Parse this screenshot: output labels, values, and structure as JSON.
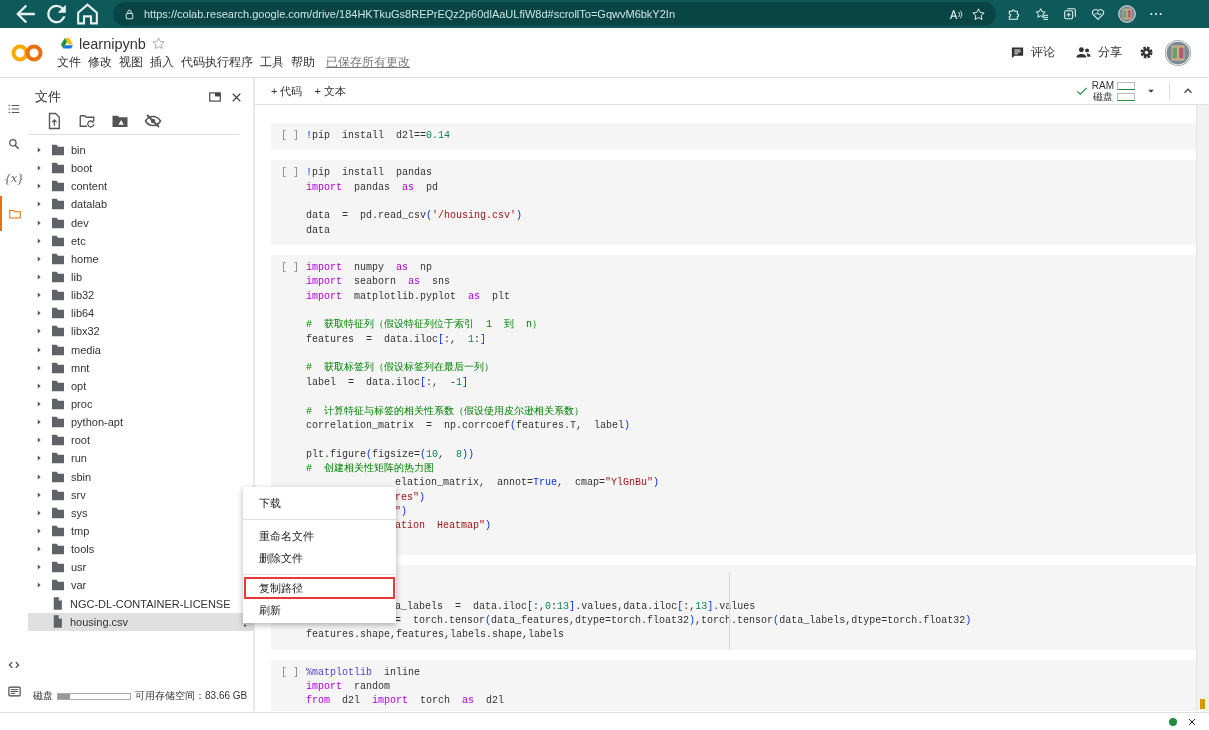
{
  "browser": {
    "url": "https://colab.research.google.com/drive/184HKTkuGs8REPrEQz2p60dlAaULfiW8d#scrollTo=GqwvM6bkY2In"
  },
  "header": {
    "title": "learnipynb",
    "menu": [
      "文件",
      "修改",
      "视图",
      "插入",
      "代码执行程序",
      "工具",
      "帮助"
    ],
    "save_status": "已保存所有更改",
    "comment": "评论",
    "share": "分享"
  },
  "toolbar": {
    "add_code": "+ 代码",
    "add_text": "+ 文本",
    "ram": "RAM",
    "disk": "磁盘"
  },
  "rail": [
    {
      "kind": "toc",
      "selected": false
    },
    {
      "kind": "search",
      "selected": false
    },
    {
      "kind": "variables",
      "glyph": "{x}",
      "selected": false
    },
    {
      "kind": "files",
      "selected": true
    }
  ],
  "rail_bottom": [
    {
      "kind": "code"
    },
    {
      "kind": "terminal"
    }
  ],
  "files": {
    "title": "文件",
    "items": [
      {
        "name": "bin",
        "kind": "folder",
        "selected": false
      },
      {
        "name": "boot",
        "kind": "folder",
        "selected": false
      },
      {
        "name": "content",
        "kind": "folder",
        "selected": false
      },
      {
        "name": "datalab",
        "kind": "folder",
        "selected": false
      },
      {
        "name": "dev",
        "kind": "folder",
        "selected": false
      },
      {
        "name": "etc",
        "kind": "folder",
        "selected": false
      },
      {
        "name": "home",
        "kind": "folder",
        "selected": false
      },
      {
        "name": "lib",
        "kind": "folder",
        "selected": false
      },
      {
        "name": "lib32",
        "kind": "folder",
        "selected": false
      },
      {
        "name": "lib64",
        "kind": "folder",
        "selected": false
      },
      {
        "name": "libx32",
        "kind": "folder",
        "selected": false
      },
      {
        "name": "media",
        "kind": "folder",
        "selected": false
      },
      {
        "name": "mnt",
        "kind": "folder",
        "selected": false
      },
      {
        "name": "opt",
        "kind": "folder",
        "selected": false
      },
      {
        "name": "proc",
        "kind": "folder",
        "selected": false
      },
      {
        "name": "python-apt",
        "kind": "folder",
        "selected": false
      },
      {
        "name": "root",
        "kind": "folder",
        "selected": false
      },
      {
        "name": "run",
        "kind": "folder",
        "selected": false
      },
      {
        "name": "sbin",
        "kind": "folder",
        "selected": false
      },
      {
        "name": "srv",
        "kind": "folder",
        "selected": false
      },
      {
        "name": "sys",
        "kind": "folder",
        "selected": false
      },
      {
        "name": "tmp",
        "kind": "folder",
        "selected": false
      },
      {
        "name": "tools",
        "kind": "folder",
        "selected": false
      },
      {
        "name": "usr",
        "kind": "folder",
        "selected": false
      },
      {
        "name": "var",
        "kind": "folder",
        "selected": false
      },
      {
        "name": "NGC-DL-CONTAINER-LICENSE",
        "kind": "file",
        "selected": false
      },
      {
        "name": "housing.csv",
        "kind": "file",
        "selected": true
      }
    ],
    "disk": {
      "label": "磁盘",
      "level": 0.17,
      "free": "可用存储空间：83.66 GB"
    }
  },
  "cells": [
    {
      "run_label": "[ ]",
      "ruler": false,
      "lines": [
        {
          "kind": "code",
          "tokens": [
            {
              "kind": "b",
              "text": "!"
            },
            {
              "kind": "p",
              "text": "pip  install  d2l=="
            },
            {
              "kind": "n",
              "text": "0.14"
            }
          ]
        }
      ]
    },
    {
      "run_label": "[ ]",
      "ruler": false,
      "lines": [
        {
          "kind": "code",
          "tokens": [
            {
              "kind": "b",
              "text": "!"
            },
            {
              "kind": "p",
              "text": "pip  install  pandas"
            }
          ]
        },
        {
          "kind": "code",
          "tokens": [
            {
              "kind": "k",
              "text": "import"
            },
            {
              "kind": "p",
              "text": "  pandas  "
            },
            {
              "kind": "k",
              "text": "as"
            },
            {
              "kind": "p",
              "text": "  pd"
            }
          ]
        },
        {
          "kind": "blank"
        },
        {
          "kind": "code",
          "tokens": [
            {
              "kind": "p",
              "text": "data  =  pd.read_csv"
            },
            {
              "kind": "b",
              "text": "("
            },
            {
              "kind": "s",
              "text": "'/housing.csv'"
            },
            {
              "kind": "b",
              "text": ")"
            }
          ]
        },
        {
          "kind": "code",
          "tokens": [
            {
              "kind": "p",
              "text": "data"
            }
          ]
        }
      ]
    },
    {
      "run_label": "[ ]",
      "ruler": false,
      "lines": [
        {
          "kind": "code",
          "tokens": [
            {
              "kind": "k",
              "text": "import"
            },
            {
              "kind": "p",
              "text": "  numpy  "
            },
            {
              "kind": "k",
              "text": "as"
            },
            {
              "kind": "p",
              "text": "  np"
            }
          ]
        },
        {
          "kind": "code",
          "tokens": [
            {
              "kind": "k",
              "text": "import"
            },
            {
              "kind": "p",
              "text": "  seaborn  "
            },
            {
              "kind": "k",
              "text": "as"
            },
            {
              "kind": "p",
              "text": "  sns"
            }
          ]
        },
        {
          "kind": "code",
          "tokens": [
            {
              "kind": "k",
              "text": "import"
            },
            {
              "kind": "p",
              "text": "  matplotlib.pyplot  "
            },
            {
              "kind": "k",
              "text": "as"
            },
            {
              "kind": "p",
              "text": "  plt"
            }
          ]
        },
        {
          "kind": "blank"
        },
        {
          "kind": "code",
          "tokens": [
            {
              "kind": "c",
              "text": "#  获取特征列（假设特征列位于索引  1  到  n）"
            }
          ]
        },
        {
          "kind": "code",
          "tokens": [
            {
              "kind": "p",
              "text": "features  =  data.iloc"
            },
            {
              "kind": "b",
              "text": "["
            },
            {
              "kind": "p",
              "text": ":,  "
            },
            {
              "kind": "n",
              "text": "1"
            },
            {
              "kind": "p",
              "text": ":"
            },
            {
              "kind": "b",
              "text": "]"
            }
          ]
        },
        {
          "kind": "blank"
        },
        {
          "kind": "code",
          "tokens": [
            {
              "kind": "c",
              "text": "#  获取标签列（假设标签列在最后一列）"
            }
          ]
        },
        {
          "kind": "code",
          "tokens": [
            {
              "kind": "p",
              "text": "label  =  data.iloc"
            },
            {
              "kind": "b",
              "text": "["
            },
            {
              "kind": "p",
              "text": ":,  -"
            },
            {
              "kind": "n",
              "text": "1"
            },
            {
              "kind": "b",
              "text": "]"
            }
          ]
        },
        {
          "kind": "blank"
        },
        {
          "kind": "code",
          "tokens": [
            {
              "kind": "c",
              "text": "#  计算特征与标签的相关性系数（假设使用皮尔逊相关系数）"
            }
          ]
        },
        {
          "kind": "code",
          "tokens": [
            {
              "kind": "p",
              "text": "correlation_matrix  =  np.corrcoef"
            },
            {
              "kind": "b",
              "text": "("
            },
            {
              "kind": "p",
              "text": "features.T,  label"
            },
            {
              "kind": "b",
              "text": ")"
            }
          ]
        },
        {
          "kind": "blank"
        },
        {
          "kind": "code",
          "tokens": [
            {
              "kind": "p",
              "text": "plt.figure"
            },
            {
              "kind": "b",
              "text": "("
            },
            {
              "kind": "p",
              "text": "figsize="
            },
            {
              "kind": "b",
              "text": "("
            },
            {
              "kind": "n",
              "text": "10"
            },
            {
              "kind": "p",
              "text": ",  "
            },
            {
              "kind": "n",
              "text": "8"
            },
            {
              "kind": "b",
              "text": "))"
            }
          ]
        },
        {
          "kind": "code",
          "tokens": [
            {
              "kind": "c",
              "text": "#  创建相关性矩阵的热力图"
            }
          ]
        },
        {
          "kind": "covered",
          "tokens": [
            {
              "kind": "p",
              "text": "elation_matrix,  annot="
            },
            {
              "kind": "b",
              "text": "True"
            },
            {
              "kind": "p",
              "text": ",  cmap="
            },
            {
              "kind": "s",
              "text": "\"YlGnBu\""
            },
            {
              "kind": "b",
              "text": ")"
            }
          ]
        },
        {
          "kind": "covered",
          "tokens": [
            {
              "kind": "s",
              "text": "res\""
            },
            {
              "kind": "b",
              "text": ")"
            }
          ]
        },
        {
          "kind": "covered",
          "tokens": [
            {
              "kind": "s",
              "text": "\""
            },
            {
              "kind": "b",
              "text": ")"
            }
          ]
        },
        {
          "kind": "covered",
          "tokens": [
            {
              "kind": "s",
              "text": "ation  Heatmap\""
            },
            {
              "kind": "b",
              "text": ")"
            }
          ]
        },
        {
          "kind": "blank"
        }
      ]
    },
    {
      "ruler": true,
      "lines": [
        {
          "kind": "blank"
        },
        {
          "kind": "blank"
        },
        {
          "kind": "covered",
          "tokens": [
            {
              "kind": "p",
              "text": "a_labels  =  data.iloc"
            },
            {
              "kind": "b",
              "text": "["
            },
            {
              "kind": "p",
              "text": ":,"
            },
            {
              "kind": "n",
              "text": "0"
            },
            {
              "kind": "p",
              "text": ":"
            },
            {
              "kind": "n",
              "text": "13"
            },
            {
              "kind": "b",
              "text": "]"
            },
            {
              "kind": "p",
              "text": ".values,data.iloc"
            },
            {
              "kind": "b",
              "text": "["
            },
            {
              "kind": "p",
              "text": ":,"
            },
            {
              "kind": "n",
              "text": "13"
            },
            {
              "kind": "b",
              "text": "]"
            },
            {
              "kind": "p",
              "text": ".values"
            }
          ]
        },
        {
          "kind": "covered",
          "tokens": [
            {
              "kind": "p",
              "text": "=  torch.tensor"
            },
            {
              "kind": "b",
              "text": "("
            },
            {
              "kind": "p",
              "text": "data_features,dtype=torch.float32"
            },
            {
              "kind": "b",
              "text": ")"
            },
            {
              "kind": "p",
              "text": ",torch.tensor"
            },
            {
              "kind": "b",
              "text": "("
            },
            {
              "kind": "p",
              "text": "data_labels,dtype=torch.float32"
            },
            {
              "kind": "b",
              "text": ")"
            }
          ]
        },
        {
          "kind": "code",
          "tokens": [
            {
              "kind": "p",
              "text": "features.shape,features,labels.shape,labels"
            }
          ]
        }
      ]
    },
    {
      "run_label": "[ ]",
      "ruler": false,
      "lines": [
        {
          "kind": "code",
          "tokens": [
            {
              "kind": "m",
              "text": "%matplotlib"
            },
            {
              "kind": "p",
              "text": "  inline"
            }
          ]
        },
        {
          "kind": "code",
          "tokens": [
            {
              "kind": "k",
              "text": "import"
            },
            {
              "kind": "p",
              "text": "  random"
            }
          ]
        },
        {
          "kind": "code",
          "tokens": [
            {
              "kind": "k",
              "text": "from"
            },
            {
              "kind": "p",
              "text": "  d2l  "
            },
            {
              "kind": "k",
              "text": "import"
            },
            {
              "kind": "p",
              "text": "  torch  "
            },
            {
              "kind": "k",
              "text": "as"
            },
            {
              "kind": "p",
              "text": "  d2l"
            }
          ]
        }
      ]
    }
  ],
  "context_menu": {
    "groups": [
      {
        "items": [
          {
            "label": "下载",
            "highlighted": false
          }
        ]
      },
      {
        "items": [
          {
            "label": "重命名文件",
            "highlighted": false
          },
          {
            "label": "删除文件",
            "highlighted": false
          }
        ]
      },
      {
        "items": [
          {
            "label": "复制路径",
            "highlighted": true
          },
          {
            "label": "刷新",
            "highlighted": false
          }
        ]
      }
    ]
  }
}
